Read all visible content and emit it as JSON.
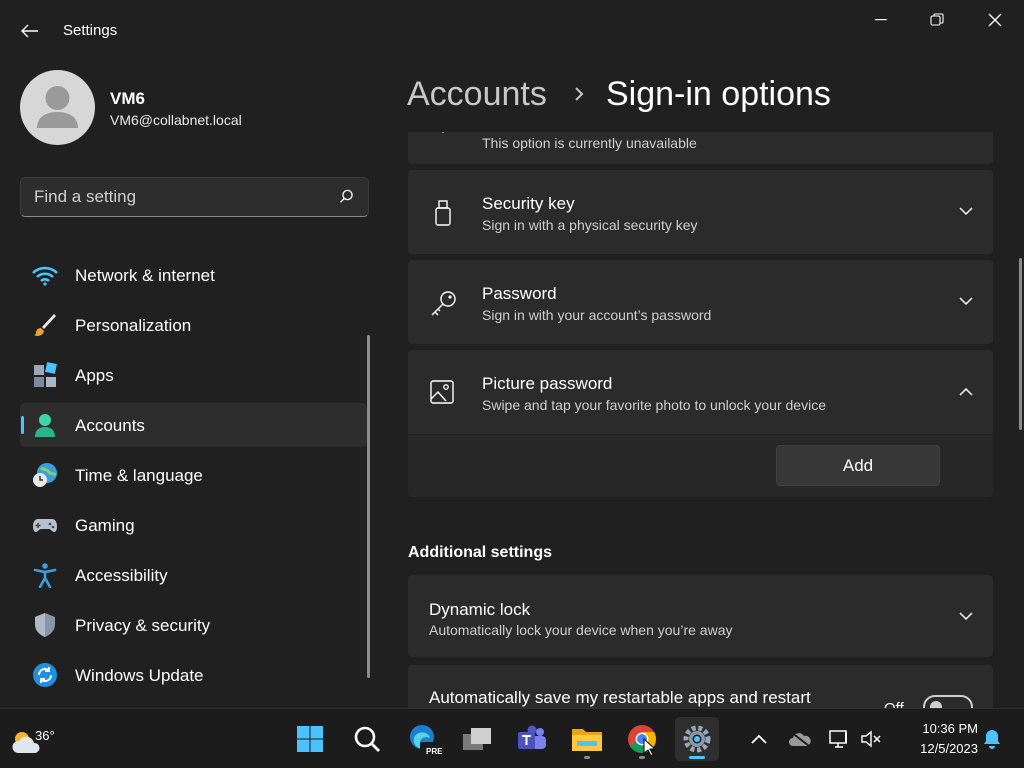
{
  "window": {
    "app_title": "Settings"
  },
  "profile": {
    "name": "VM6",
    "email": "VM6@collabnet.local"
  },
  "search": {
    "placeholder": "Find a setting"
  },
  "sidebar": {
    "items": [
      {
        "label": "Network & internet",
        "icon": "wifi-icon"
      },
      {
        "label": "Personalization",
        "icon": "brush-icon"
      },
      {
        "label": "Apps",
        "icon": "apps-icon"
      },
      {
        "label": "Accounts",
        "icon": "person-icon",
        "active": true
      },
      {
        "label": "Time & language",
        "icon": "globe-clock-icon"
      },
      {
        "label": "Gaming",
        "icon": "gamepad-icon"
      },
      {
        "label": "Accessibility",
        "icon": "accessibility-icon"
      },
      {
        "label": "Privacy & security",
        "icon": "shield-icon"
      },
      {
        "label": "Windows Update",
        "icon": "update-icon"
      }
    ]
  },
  "header": {
    "parent": "Accounts",
    "current": "Sign-in options"
  },
  "content": {
    "partial_card": {
      "subtitle": "This option is currently unavailable"
    },
    "cards": [
      {
        "title": "Security key",
        "subtitle": "Sign in with a physical security key",
        "icon": "usb-key-icon"
      },
      {
        "title": "Password",
        "subtitle": "Sign in with your account’s password",
        "icon": "key-icon"
      },
      {
        "title": "Picture password",
        "subtitle": "Swipe and tap your favorite photo to unlock your device",
        "icon": "picture-icon"
      }
    ],
    "add_label": "Add",
    "additional_heading": "Additional settings",
    "dynamic_lock": {
      "title": "Dynamic lock",
      "subtitle": "Automatically lock your device when you’re away"
    },
    "auto_save": {
      "title": "Automatically save my restartable apps and restart",
      "toggle_label": "Off"
    }
  },
  "taskbar": {
    "weather_temp": "36°",
    "pinned": [
      "start-icon",
      "search-icon",
      "edge-preview-icon",
      "task-view-icon",
      "teams-icon",
      "file-explorer-icon",
      "chrome-icon",
      "settings-icon"
    ],
    "edge_badge": "PRE",
    "clock_time": "10:36 PM",
    "clock_date": "12/5/2023"
  },
  "colors": {
    "accent": "#4cc2ff",
    "background": "#202020",
    "card": "#2b2b2b"
  }
}
